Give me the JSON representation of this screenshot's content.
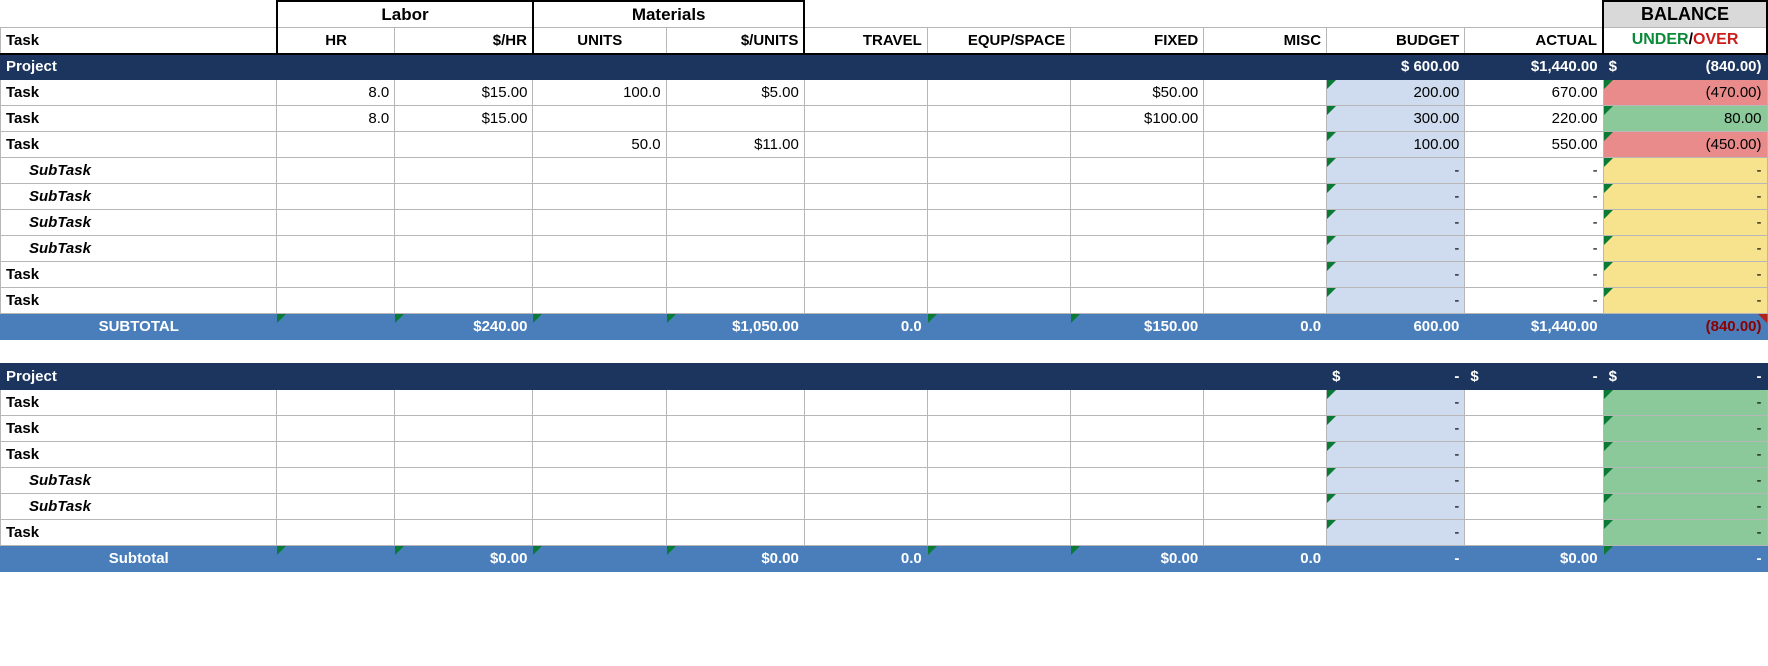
{
  "headers": {
    "task": "Task",
    "labor": "Labor",
    "materials": "Materials",
    "hr": "HR",
    "rate": "$/HR",
    "units": "UNITS",
    "unit_rate": "$/UNITS",
    "travel": "TRAVEL",
    "equip": "EQUP/SPACE",
    "fixed": "FIXED",
    "misc": "MISC",
    "budget": "BUDGET",
    "actual": "ACTUAL",
    "balance": "BALANCE",
    "under": "UNDER",
    "over": "OVER"
  },
  "p1": {
    "name": "Project",
    "budget": "$   600.00",
    "actual": "$1,440.00",
    "balance_prefix": "$",
    "balance": "(840.00)",
    "rows": [
      {
        "name": "Task",
        "hr": "8.0",
        "rate": "$15.00",
        "units": "100.0",
        "urate": "$5.00",
        "fixed": "$50.00",
        "budget": "200.00",
        "actual": "670.00",
        "balance": "(470.00)",
        "bal": "red"
      },
      {
        "name": "Task",
        "hr": "8.0",
        "rate": "$15.00",
        "fixed": "$100.00",
        "budget": "300.00",
        "actual": "220.00",
        "balance": "80.00",
        "bal": "green"
      },
      {
        "name": "Task",
        "units": "50.0",
        "urate": "$11.00",
        "budget": "100.00",
        "actual": "550.00",
        "balance": "(450.00)",
        "bal": "red"
      },
      {
        "name": "SubTask",
        "sub": true,
        "budget": "-",
        "actual": "-",
        "balance": "-",
        "bal": "yellow"
      },
      {
        "name": "SubTask",
        "sub": true,
        "budget": "-",
        "actual": "-",
        "balance": "-",
        "bal": "yellow"
      },
      {
        "name": "SubTask",
        "sub": true,
        "budget": "-",
        "actual": "-",
        "balance": "-",
        "bal": "yellow"
      },
      {
        "name": "SubTask",
        "sub": true,
        "budget": "-",
        "actual": "-",
        "balance": "-",
        "bal": "yellow"
      },
      {
        "name": "Task",
        "budget": "-",
        "actual": "-",
        "balance": "-",
        "bal": "yellow"
      },
      {
        "name": "Task",
        "budget": "-",
        "actual": "-",
        "balance": "-",
        "bal": "yellow"
      }
    ],
    "subtotal": {
      "label": "SUBTOTAL",
      "rate": "$240.00",
      "urate": "$1,050.00",
      "travel": "0.0",
      "fixed": "$150.00",
      "misc": "0.0",
      "budget": "600.00",
      "actual": "$1,440.00",
      "balance": "(840.00)"
    }
  },
  "p2": {
    "name": "Project",
    "budget_prefix": "$",
    "budget": "-",
    "actual_prefix": "$",
    "actual": "-",
    "balance_prefix": "$",
    "balance": "-",
    "rows": [
      {
        "name": "Task",
        "budget": "-",
        "balance": "-",
        "bal": "green"
      },
      {
        "name": "Task",
        "budget": "-",
        "balance": "-",
        "bal": "green"
      },
      {
        "name": "Task",
        "budget": "-",
        "balance": "-",
        "bal": "green"
      },
      {
        "name": "SubTask",
        "sub": true,
        "budget": "-",
        "balance": "-",
        "bal": "green"
      },
      {
        "name": "SubTask",
        "sub": true,
        "budget": "-",
        "balance": "-",
        "bal": "green"
      },
      {
        "name": "Task",
        "budget": "-",
        "balance": "-",
        "bal": "green"
      }
    ],
    "subtotal": {
      "label": "Subtotal",
      "rate": "$0.00",
      "urate": "$0.00",
      "travel": "0.0",
      "fixed": "$0.00",
      "misc": "0.0",
      "budget": "-",
      "actual": "$0.00",
      "balance": "-"
    }
  }
}
